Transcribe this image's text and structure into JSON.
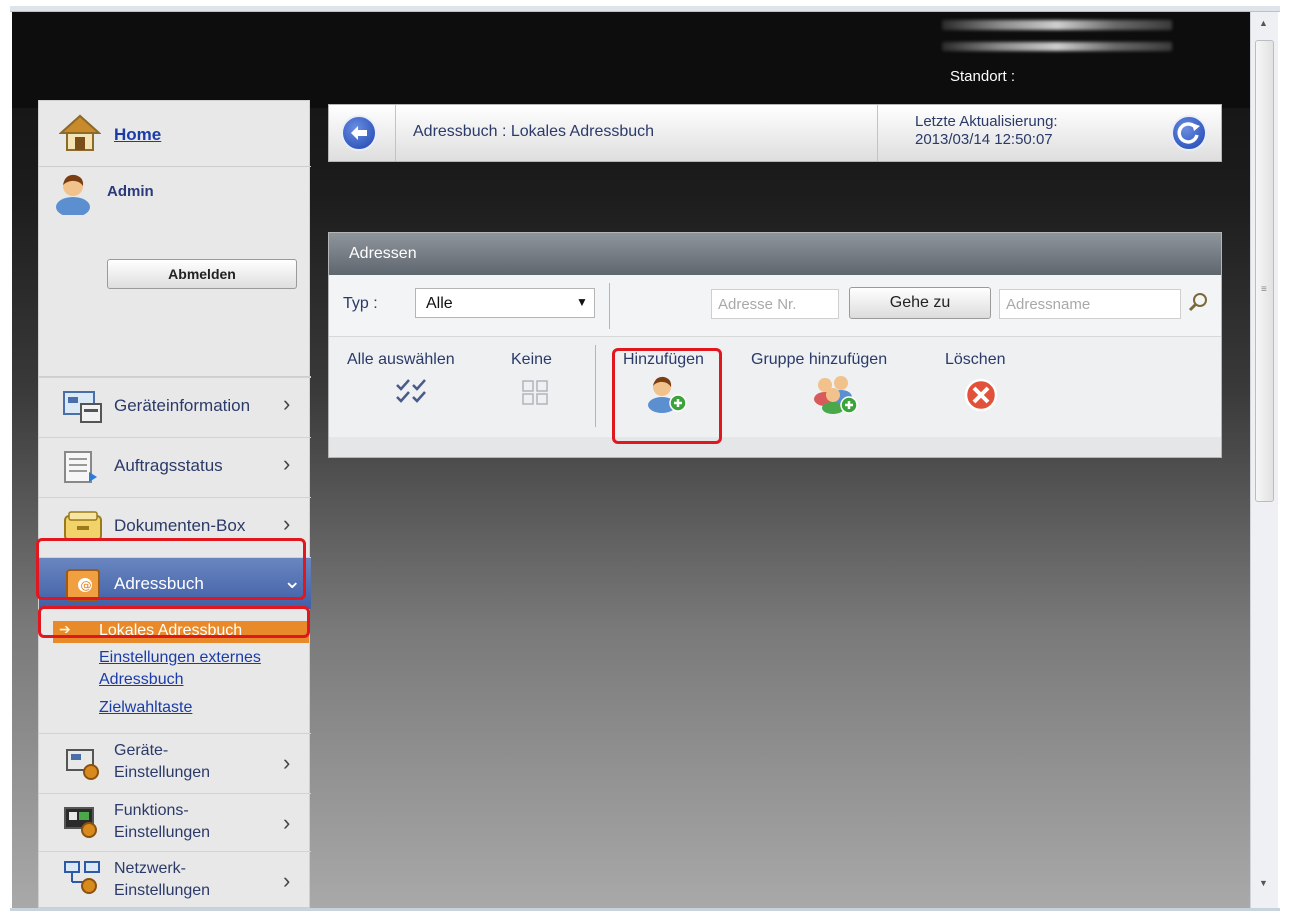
{
  "header": {
    "location_label": "Standort :"
  },
  "sidebar": {
    "home_label": "Home",
    "user_label": "Admin",
    "logout_label": "Abmelden",
    "nav": [
      {
        "label": "Geräteinformation"
      },
      {
        "label": "Auftragsstatus"
      },
      {
        "label": "Dokumenten-Box"
      },
      {
        "label": "Adressbuch"
      },
      {
        "label_line1": "Geräte-",
        "label_line2": "Einstellungen"
      },
      {
        "label_line1": "Funktions-",
        "label_line2": "Einstellungen"
      },
      {
        "label_line1": "Netzwerk-",
        "label_line2": "Einstellungen"
      }
    ],
    "addressbook_sub": {
      "active": "Lokales Adressbuch",
      "external_line1": "Einstellungen externes",
      "external_line2": "Adressbuch",
      "speed_dial": "Zielwahltaste"
    }
  },
  "breadcrumb": {
    "path": "Adressbuch : Lokales Adressbuch",
    "update_label": "Letzte Aktualisierung:",
    "update_time": "2013/03/14 12:50:07"
  },
  "panel": {
    "title": "Adressen",
    "type_label": "Typ :",
    "type_value": "Alle",
    "address_no_placeholder": "Adresse Nr.",
    "goto_label": "Gehe zu",
    "address_name_placeholder": "Adressname",
    "actions": {
      "select_all": "Alle auswählen",
      "none": "Keine",
      "add": "Hinzufügen",
      "add_group": "Gruppe hinzufügen",
      "delete": "Löschen"
    }
  },
  "colors": {
    "highlight_red": "#e0171f",
    "active_nav": "#4a68ad",
    "active_sub": "#e88a2a",
    "link_blue": "#1a3ca8"
  }
}
